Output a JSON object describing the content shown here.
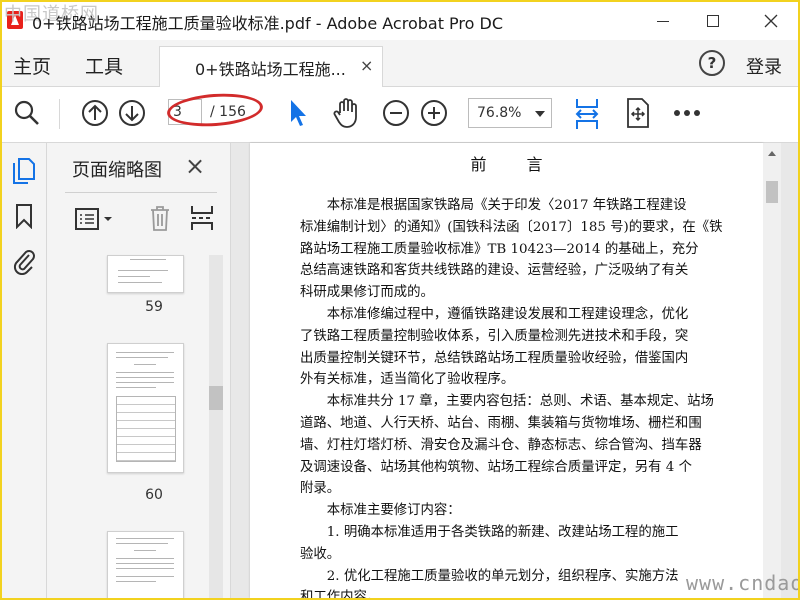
{
  "window": {
    "title": "0+铁路站场工程施工质量验收标准.pdf - Adobe Acrobat Pro DC",
    "watermark_top": "中国道桥网",
    "watermark_bottom": "www.cndao.com"
  },
  "menubar": {
    "home": "主页",
    "tools": "工具",
    "tab_label": "0+铁路站场工程施...",
    "tab_close": "×",
    "help": "?",
    "login": "登录"
  },
  "toolbar": {
    "page_current": "3",
    "page_total": "/ 156",
    "zoom": "76.8%"
  },
  "panel": {
    "title": "页面缩略图",
    "close": "×",
    "thumbnails": [
      {
        "page": "59"
      },
      {
        "page": "60"
      }
    ]
  },
  "document": {
    "heading": "前言",
    "lines": [
      "　　本标准是根据国家铁路局《关于印发〈2017 年铁路工程建设",
      "标准编制计划〉的通知》(国铁科法函〔2017〕185 号)的要求，在《铁",
      "路站场工程施工质量验收标准》TB 10423—2014 的基础上，充分",
      "总结高速铁路和客货共线铁路的建设、运营经验，广泛吸纳了有关",
      "科研成果修订而成的。",
      "　　本标准修编过程中，遵循铁路建设发展和工程建设理念，优化",
      "了铁路工程质量控制验收体系，引入质量检测先进技术和手段，突",
      "出质量控制关键环节，总结铁路站场工程质量验收经验，借鉴国内",
      "外有关标准，适当简化了验收程序。",
      "　　本标准共分 17 章，主要内容包括：总则、术语、基本规定、站场",
      "道路、地道、人行天桥、站台、雨棚、集装箱与货物堆场、栅栏和围",
      "墙、灯柱灯塔灯桥、滑安仓及漏斗仓、静态标志、综合管沟、挡车器",
      "及调速设备、站场其他构筑物、站场工程综合质量评定，另有 4 个",
      "附录。",
      "　　本标准主要修订内容：",
      "　　1. 明确本标准适用于各类铁路的新建、改建站场工程的施工",
      "验收。",
      "　　2. 优化工程施工质量验收的单元划分，组织程序、实施方法",
      "和工作内容。"
    ]
  },
  "colors": {
    "accent_blue": "#1473e6",
    "highlight_red": "#d22b2b",
    "frame_yellow": "#f2d21f"
  }
}
